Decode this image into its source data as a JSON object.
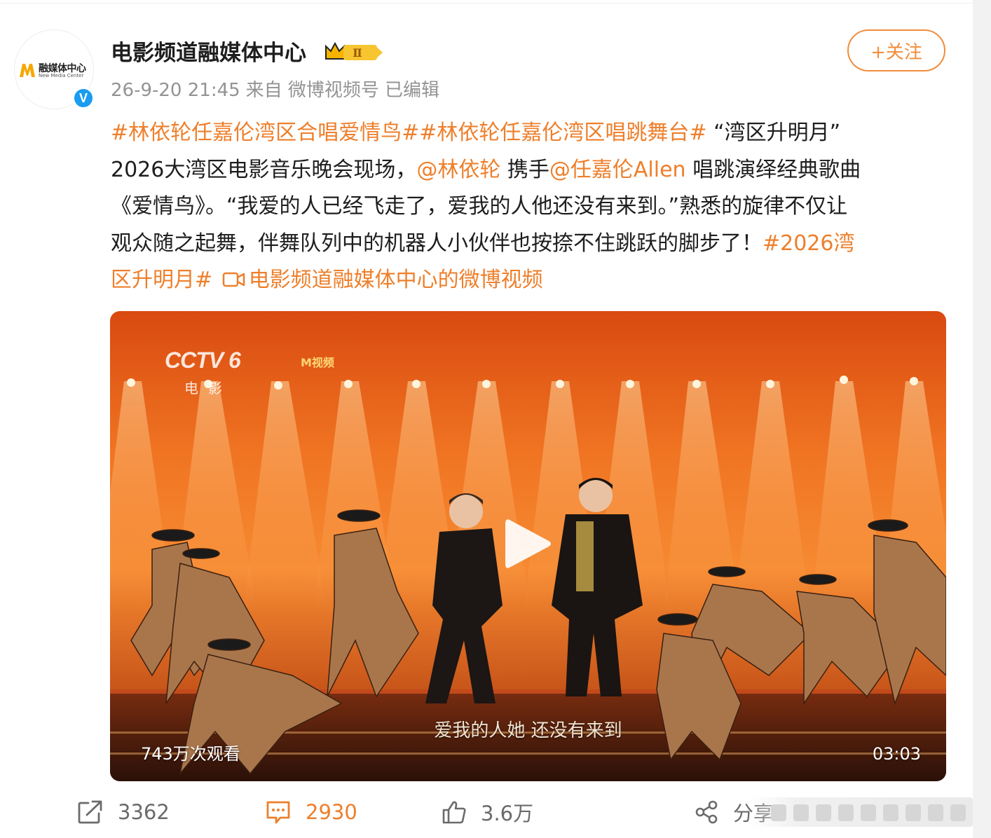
{
  "account": {
    "name": "电影频道融媒体中心",
    "avatar_text": "融媒体中心",
    "avatar_subtext": "New Media Center",
    "verified_mark": "V"
  },
  "badge": {
    "level": "Ⅱ"
  },
  "meta": {
    "timestamp": "26-9-20 21:45",
    "source": "来自 微博视频号",
    "edited": "已编辑"
  },
  "follow_button": "+关注",
  "post": {
    "line1": {
      "tag1": "#林依轮任嘉伦湾区合唱爱情鸟#",
      "tag2": "#林依轮任嘉伦湾区唱跳舞台#",
      "text": " “湾区升明月”"
    },
    "line2": {
      "text_a": "2026大湾区电影音乐晚会现场，",
      "mention1": "@林依轮",
      "text_b": " 携手",
      "mention2": "@任嘉伦Allen",
      "text_c": " 唱跳演绎经典歌曲"
    },
    "line3": "《爱情鸟》。“我爱的人已经飞走了，爱我的人他还没有来到。”熟悉的旋律不仅让",
    "line4": {
      "text": "观众随之起舞，伴舞队列中的机器人小伙伴也按捺不住跳跃的脚步了！",
      "tag3_start": "#2026湾"
    },
    "line5": {
      "tag3_end": "区升明月#",
      "video_link": "电影频道融媒体中心的微博视频"
    }
  },
  "video": {
    "channel_logo": "CCTV 6",
    "channel_sub": "电影",
    "app_logo": "M视频",
    "subtitle": "爱我的人她 还没有来到",
    "views": "743万次观看",
    "duration": "03:03"
  },
  "actions": {
    "repost_count": "3362",
    "comment_count": "2930",
    "like_count": "3.6万",
    "share_label": "分享"
  },
  "colors": {
    "accent": "#ee7f2b",
    "follow": "#f18d3b",
    "verified": "#1a9cf0",
    "meta_gray": "#939393"
  }
}
